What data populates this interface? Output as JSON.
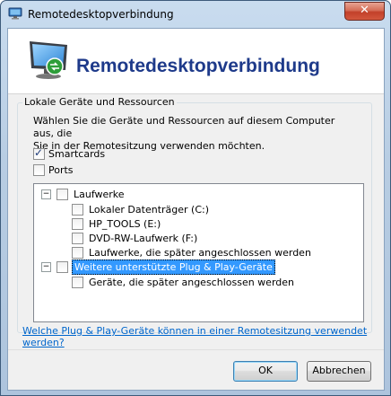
{
  "window": {
    "title": "Remotedesktopverbindung",
    "close_glyph": "✕"
  },
  "header": {
    "title": "Remotedesktopverbindung"
  },
  "group": {
    "label": "Lokale Geräte und Ressourcen",
    "description_line1": "Wählen Sie die Geräte und Ressourcen auf diesem Computer aus, die",
    "description_line2": "Sie in der Remotesitzung verwenden möchten.",
    "smartcards": {
      "label": "Smartcards",
      "checked": true
    },
    "ports": {
      "label": "Ports",
      "checked": false
    }
  },
  "tree": {
    "drives": {
      "label": "Laufwerke",
      "expander": "−",
      "children": [
        "Lokaler Datenträger (C:)",
        "HP_TOOLS (E:)",
        "DVD-RW-Laufwerk (F:)",
        "Laufwerke, die später angeschlossen werden"
      ]
    },
    "pnp": {
      "label": "Weitere unterstützte Plug & Play-Geräte",
      "expander": "−",
      "children": [
        "Geräte, die später angeschlossen werden"
      ]
    }
  },
  "help_link": "Welche Plug & Play-Geräte können in einer Remotesitzung verwendet werden?",
  "buttons": {
    "ok": "OK",
    "cancel": "Abbrechen"
  }
}
